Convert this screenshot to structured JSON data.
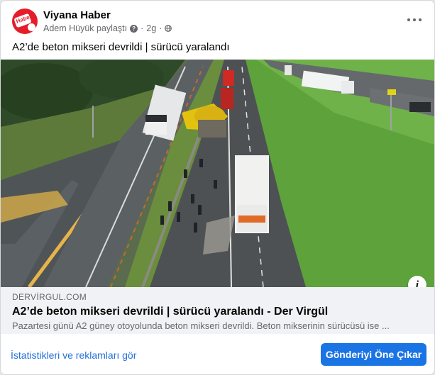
{
  "post": {
    "page_name": "Viyana Haber",
    "avatar_text": "Haber",
    "shared_by": "Adem Hüyük paylaştı",
    "time": "2g",
    "text": "A2’de beton mikseri devrildi | sürücü yaralandı"
  },
  "link_preview": {
    "domain": "DERVİRGUL.COM",
    "title": "A2’de beton mikseri devrildi | sürücü yaralandı - Der Virgül",
    "description": "Pazartesi günü A2 güney otoyolunda beton mikseri devrildi. Beton mikserinin sürücüsü ise ..."
  },
  "footer": {
    "stats_label": "İstatistikleri ve reklamları gör",
    "boost_label": "Gönderiyi Öne Çıkar"
  },
  "colors": {
    "accent": "#1b74e4",
    "link": "#216fdb",
    "avatar_bg": "#e51d2a"
  }
}
